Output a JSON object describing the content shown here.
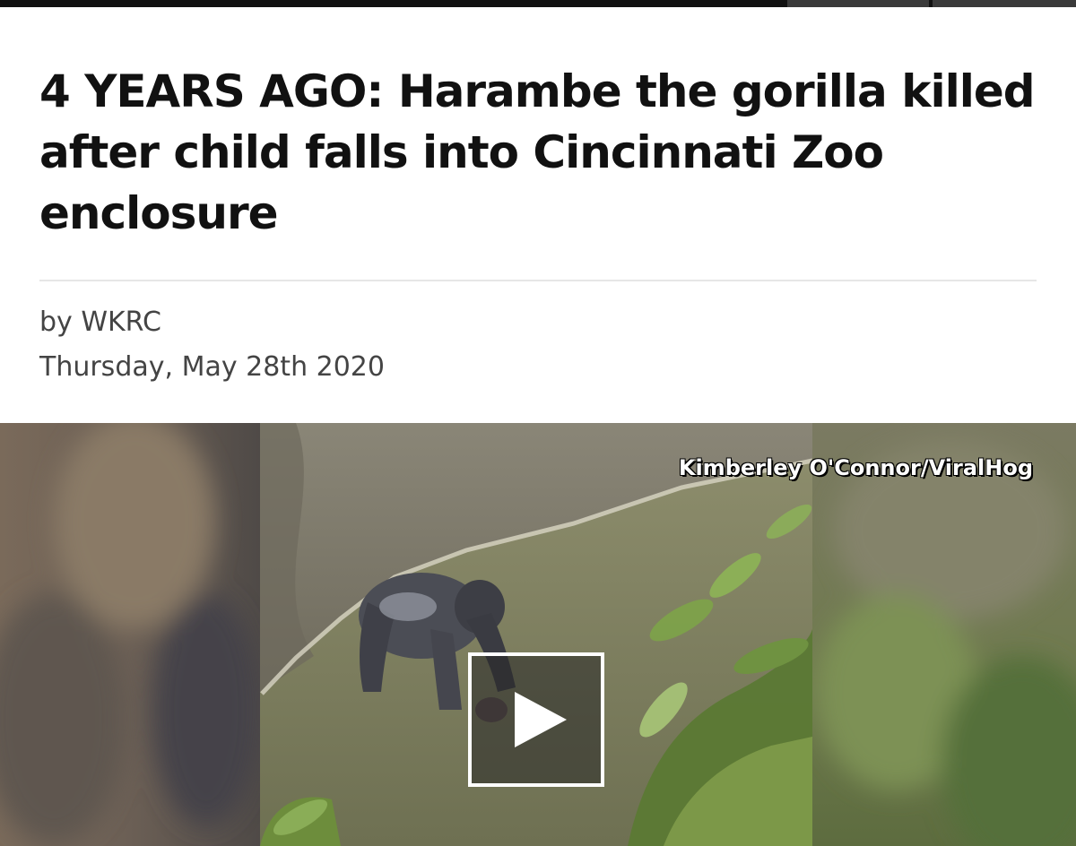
{
  "article": {
    "headline": "4 YEARS AGO: Harambe the gorilla killed after child falls into Cincinnati Zoo enclosure",
    "byline": "by WKRC",
    "date": "Thursday, May 28th 2020"
  },
  "video": {
    "credit": "Kimberley O'Connor/ViralHog",
    "play_icon": "play-icon"
  },
  "colors": {
    "headline": "#111111",
    "meta_text": "#444444",
    "divider": "#e6e6e6"
  }
}
